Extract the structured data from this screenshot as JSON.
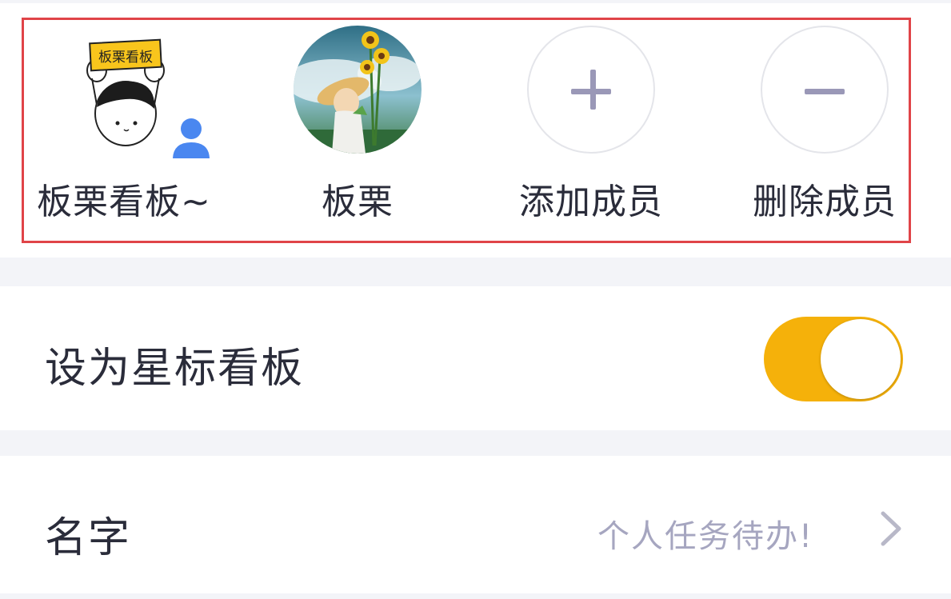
{
  "members": {
    "items": [
      {
        "label": "板栗看板~",
        "type": "avatar",
        "avatar_text": "板栗看板",
        "badge": "person-icon"
      },
      {
        "label": "板栗",
        "type": "avatar"
      },
      {
        "label": "添加成员",
        "type": "action",
        "icon": "plus-icon"
      },
      {
        "label": "删除成员",
        "type": "action",
        "icon": "minus-icon"
      }
    ]
  },
  "settings": {
    "star_board": {
      "label": "设为星标看板",
      "enabled": true
    },
    "name": {
      "label": "名字",
      "value": "个人任务待办!"
    }
  },
  "colors": {
    "accent": "#f5b10a",
    "highlight": "#e04448",
    "icon_gray": "#9a98b7",
    "badge_blue": "#4a87f0"
  }
}
